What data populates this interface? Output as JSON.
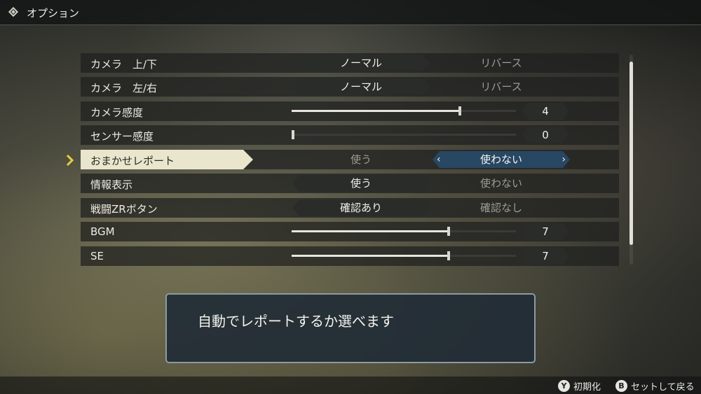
{
  "header": {
    "title": "オプション",
    "icon": "diamond-menu-icon"
  },
  "options": [
    {
      "label": "カメラ　上/下",
      "type": "choice",
      "choices": [
        "ノーマル",
        "リバース"
      ],
      "selected_index": 0
    },
    {
      "label": "カメラ　左/右",
      "type": "choice",
      "choices": [
        "ノーマル",
        "リバース"
      ],
      "selected_index": 0
    },
    {
      "label": "カメラ感度",
      "type": "slider",
      "value": "4",
      "fraction": 0.75
    },
    {
      "label": "センサー感度",
      "type": "slider",
      "value": "0",
      "fraction": 0.0
    },
    {
      "label": "おまかせレポート",
      "type": "choice",
      "choices": [
        "使う",
        "使わない"
      ],
      "selected_index": 1,
      "focused": true
    },
    {
      "label": "情報表示",
      "type": "choice",
      "choices": [
        "使う",
        "使わない"
      ],
      "selected_index": 0
    },
    {
      "label": "戦闘ZRボタン",
      "type": "choice",
      "choices": [
        "確認あり",
        "確認なし"
      ],
      "selected_index": 0
    },
    {
      "label": "BGM",
      "type": "slider",
      "value": "7",
      "fraction": 0.7
    },
    {
      "label": "SE",
      "type": "slider",
      "value": "7",
      "fraction": 0.7
    }
  ],
  "description": "自動でレポートするか選べます",
  "footer": {
    "reset": {
      "button": "Y",
      "label": "初期化"
    },
    "back": {
      "button": "B",
      "label": "セットして戻る"
    }
  },
  "colors": {
    "selected_bg": "#274763",
    "focus_label_bg": "#e9e6cd",
    "cursor": "#e2d23a"
  }
}
